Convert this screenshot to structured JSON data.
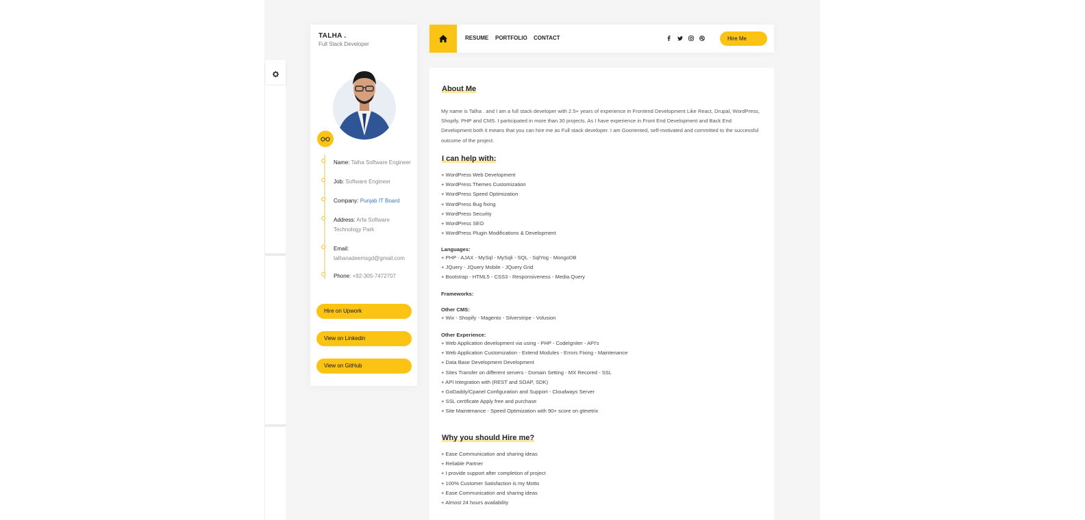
{
  "profile": {
    "name": "TALHA .",
    "role": "Full Stack Developer",
    "info": [
      {
        "key": "Name:",
        "value": "Talha Software Engineer"
      },
      {
        "key": "Job:",
        "value": "Software Engineer"
      },
      {
        "key": "Company:",
        "value": "Punjab IT Board"
      },
      {
        "key": "Address:",
        "value": "Arfa Software Technology Park"
      },
      {
        "key": "Email:",
        "value": "talhanadeemsgd@gmail.com"
      },
      {
        "key": "Phone:",
        "value": "+92-305-7472707"
      }
    ],
    "buttons": {
      "upwork": "Hire on Upwork",
      "linkedin": "View on Linkedin",
      "github": "View on GitHub"
    }
  },
  "nav": {
    "links": [
      "RESUME",
      "PORTFOLIO",
      "CONTACT"
    ],
    "hire": "Hire Me",
    "socials": [
      "facebook-icon",
      "twitter-icon",
      "instagram-icon",
      "dribbble-icon"
    ]
  },
  "about": {
    "title": "About Me",
    "text": "My name is Talha . and I am a full stack developer with 2.5+ years of experience in Frontend Development Like React, Drupal, WordPress, Shopify, PHP and CMS. I participated in more than 30 projects. As I have experience in Front End Development and Back End Development both it means that you can hire me as Full stack developer. I am Gooriented, self-motivated and committed to the successful outcome of the project."
  },
  "help": {
    "title": "I can help with:",
    "items": [
      "+ WordPress Web Development",
      "+ WordPress Themes Customization",
      "+ WordPress Speed Optimization",
      "+ WordPress Bug fixing",
      "+ WordPress Security",
      "+ WordPress SEO",
      "+ WordPress Plugin Modifications & Development"
    ],
    "languages_label": "Languages:",
    "languages": [
      "+ PHP - AJAX - MySql - MySqli - SQL - SqlYog - MongoDB",
      "+ JQuery - JQuery Mobile - JQuery Grid",
      "+ Bootstrap - HTML5 - CSS3 - Responsiveness - Media Query"
    ],
    "frameworks_label": "Frameworks:",
    "cms_label": "Other CMS:",
    "cms": [
      "+ Wix - Shopify - Magento - Silverstripe - Volusion"
    ],
    "experience_label": "Other Experience:",
    "experience": [
      "+ Web Application development via using - PHP - CodeIgniter - API's",
      "+ Web Application Customization - Extend Modules - Errors Fixing - Maintenance",
      "+ Data Base Development Development",
      "+ Sites Transfer on different servers - Domain Setting - MX Recored - SSL",
      "+ API Integration with (REST and SOAP, SDK)",
      "+ GoDaddy/Cpanel Configuration and Support - Cloudways Server",
      "+ SSL certificate Apply free and purchase",
      "+ Site Maintenance - Speed Optimization with 90+ score on gtmetrix"
    ]
  },
  "why": {
    "title": "Why you should Hire me?",
    "items": [
      "+ Ease Communication and sharing ideas",
      "+ Reliable Partner",
      "+ I provide support after completion of project",
      "+ 100% Customer Satisfaction is my Motto",
      "+ Ease Communication and sharing ideas",
      "+ Almost 24 hours availability"
    ]
  },
  "colors": {
    "accent": "#fbc314",
    "link": "#3a78c9"
  }
}
